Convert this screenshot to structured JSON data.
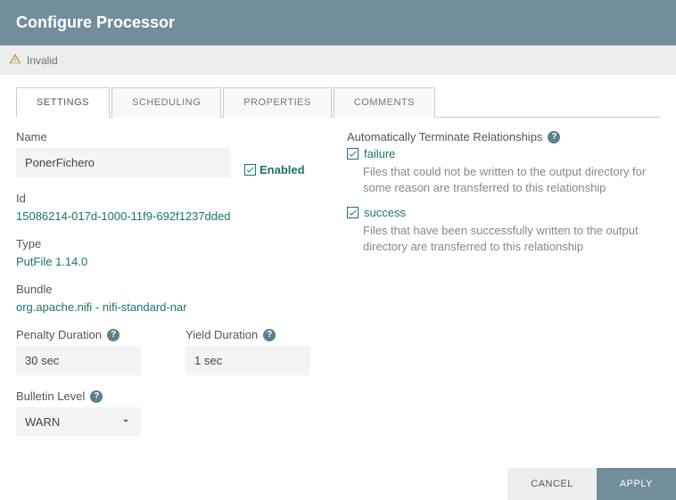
{
  "header": {
    "title": "Configure Processor"
  },
  "status": {
    "text": "Invalid"
  },
  "tabs": [
    {
      "id": "settings",
      "label": "SETTINGS"
    },
    {
      "id": "scheduling",
      "label": "SCHEDULING"
    },
    {
      "id": "properties",
      "label": "PROPERTIES"
    },
    {
      "id": "comments",
      "label": "COMMENTS"
    }
  ],
  "settings": {
    "name_label": "Name",
    "name_value": "PonerFichero",
    "enabled_label": "Enabled",
    "id_label": "Id",
    "id_value": "15086214-017d-1000-11f9-692f1237dded",
    "type_label": "Type",
    "type_value": "PutFile 1.14.0",
    "bundle_label": "Bundle",
    "bundle_value": "org.apache.nifi - nifi-standard-nar",
    "penalty_label": "Penalty Duration",
    "penalty_value": "30 sec",
    "yield_label": "Yield Duration",
    "yield_value": "1 sec",
    "bulletin_label": "Bulletin Level",
    "bulletin_value": "WARN"
  },
  "relationships": {
    "header": "Automatically Terminate Relationships",
    "items": [
      {
        "name": "failure",
        "desc": "Files that could not be written to the output directory for some reason are transferred to this relationship"
      },
      {
        "name": "success",
        "desc": "Files that have been successfully written to the output directory are transferred to this relationship"
      }
    ]
  },
  "footer": {
    "cancel": "CANCEL",
    "apply": "APPLY"
  }
}
